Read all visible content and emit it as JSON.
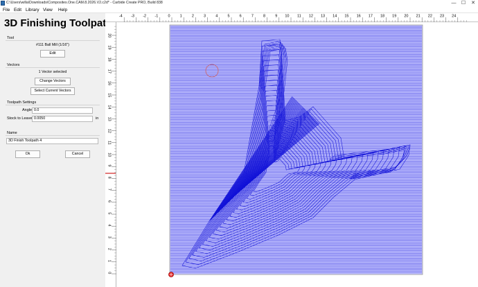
{
  "window": {
    "title": "C:\\Users\\willa\\Downloads\\Composites.One.CAM.8.2026.V2.c2d* - Carbide Create PRO, Build 838",
    "minimize_glyph": "—",
    "maximize_glyph": "☐",
    "close_glyph": "✕"
  },
  "menu": [
    {
      "label": "File"
    },
    {
      "label": "Edit"
    },
    {
      "label": "Library"
    },
    {
      "label": "View"
    },
    {
      "label": "Help"
    }
  ],
  "panel": {
    "title": "3D Finishing Toolpath",
    "tool": {
      "section_label": "Tool",
      "tool_name": "#111 Ball Mill (1/16\")",
      "edit_button": "Edit"
    },
    "vectors": {
      "section_label": "Vectors",
      "status": "1 Vector selected",
      "change_button": "Change Vectors",
      "select_button": "Select Current Vectors"
    },
    "settings": {
      "section_label": "Toolpath Settings",
      "angle_label": "Angle",
      "angle_value": "0.0",
      "stock_label": "Stock to Leave",
      "stock_value": "0.0050",
      "stock_unit": "in"
    },
    "name": {
      "section_label": "Name",
      "value": "3D Finish Toolpath 4"
    },
    "ok_button": "Ok",
    "cancel_button": "Cancel"
  },
  "view": {
    "x_ticks": [
      "-4",
      "-3",
      "-2",
      "-1",
      "0",
      "1",
      "2",
      "3",
      "4",
      "5",
      "6",
      "7",
      "8",
      "9",
      "10",
      "11",
      "12",
      "13",
      "14",
      "15",
      "16",
      "17",
      "18",
      "19",
      "20",
      "21",
      "22",
      "23",
      "24"
    ],
    "y_ticks": [
      "0",
      "1",
      "2",
      "3",
      "4",
      "5",
      "6",
      "7",
      "8",
      "9",
      "10",
      "11",
      "12",
      "13",
      "14",
      "15",
      "16",
      "17",
      "18",
      "19",
      "20"
    ],
    "stock_width": 20,
    "stock_height": 20.5,
    "colors": {
      "toolpath": "#1212d8",
      "stock_fill": "#c8c8ff",
      "origin": "#e02020",
      "cursor_circle": "#d06060",
      "ruler_marker": "#d02020"
    }
  }
}
